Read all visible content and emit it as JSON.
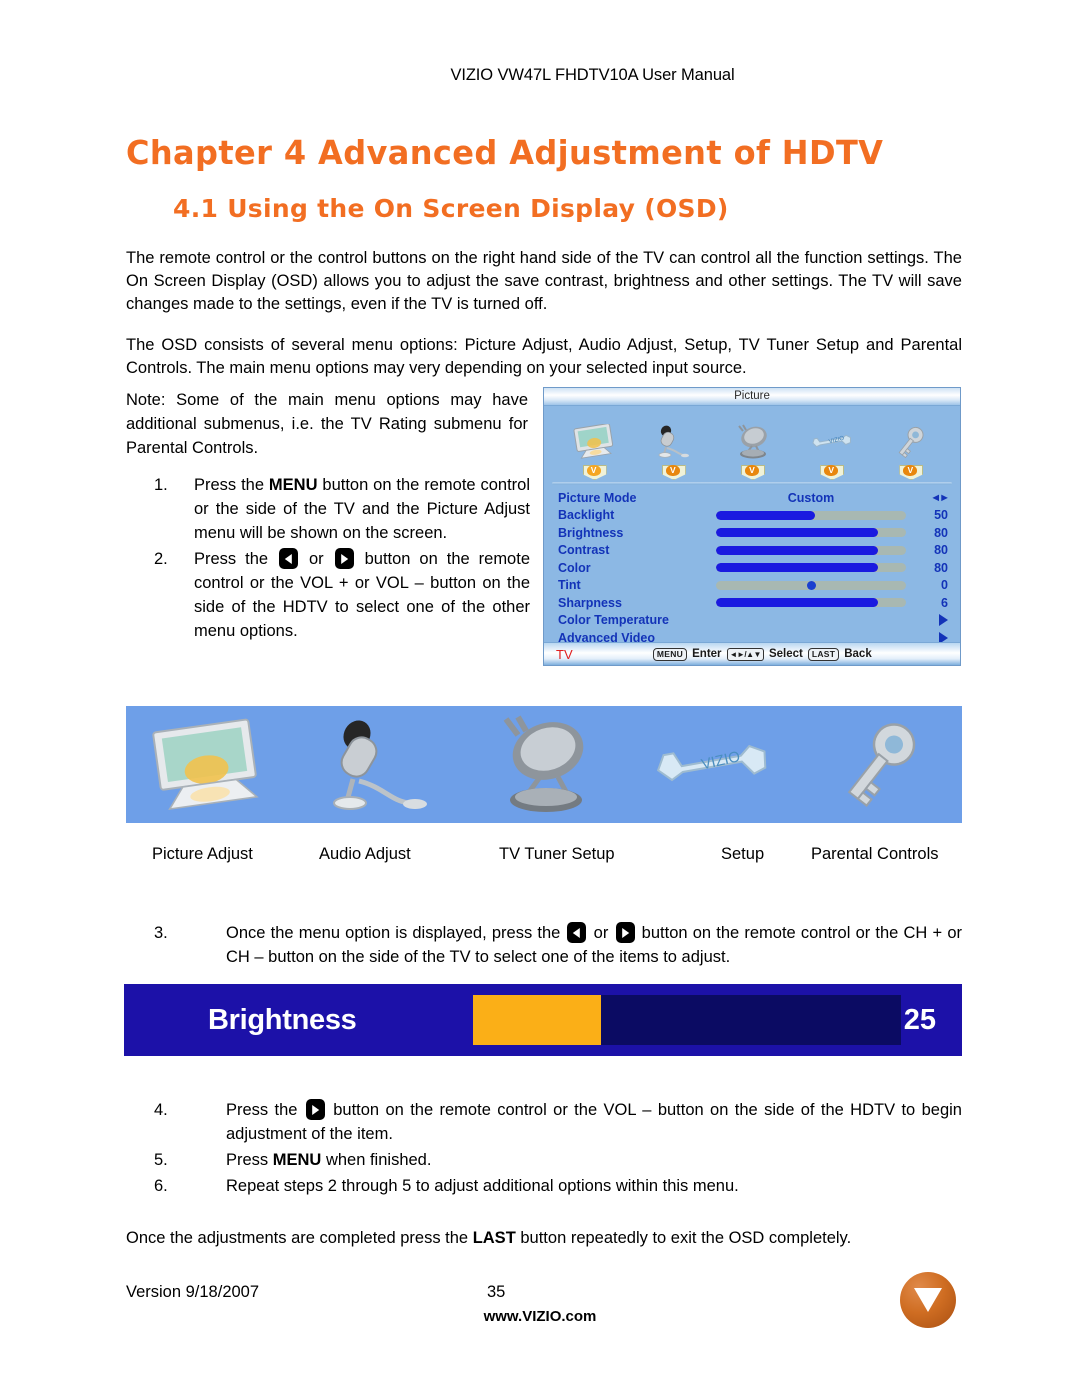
{
  "header": {
    "running_title": "VIZIO VW47L FHDTV10A User Manual"
  },
  "headings": {
    "chapter": "Chapter 4 Advanced Adjustment of HDTV",
    "section": "4.1 Using the On Screen Display (OSD)",
    "accent_color": "#F26E22"
  },
  "paragraphs": {
    "intro": "The remote control or the control buttons on the right hand side of the TV can control all the function settings.  The On Screen Display (OSD) allows you to adjust the save contrast, brightness and other settings.  The TV will save changes made to the settings, even if the TV is turned off.",
    "osd_overview": "The OSD consists of several menu options: Picture Adjust, Audio Adjust, Setup, TV Tuner Setup and Parental Controls.  The main menu options may very depending on your selected input source.",
    "note": "Note:  Some of the main menu options may have additional submenus, i.e. the TV Rating submenu for Parental Controls.",
    "closing_pre": "Once the adjustments are completed press the ",
    "closing_bold": "LAST",
    "closing_post": " button repeatedly to exit the OSD completely."
  },
  "steps": {
    "one": {
      "num": "1.",
      "pre": "Press the ",
      "bold": "MENU",
      "post": " button on the remote control or the side of the TV and the Picture Adjust menu will be shown on the screen."
    },
    "two": {
      "num": "2.",
      "seg1": "Press the ",
      "seg2": " or ",
      "seg3": " button on the remote control or the VOL + or VOL – button on the side of the HDTV to select one of the other menu options."
    },
    "three": {
      "num": "3.",
      "seg1": "Once the menu option is displayed, press the ",
      "seg2": " or ",
      "seg3": " button on the remote control or the CH + or CH – button on the side of the TV to select one of the items to adjust."
    },
    "four": {
      "num": "4.",
      "seg1": "Press the ",
      "seg2": " button on the remote control or the VOL – button on the side of the HDTV to begin adjustment of the item."
    },
    "five": {
      "num": "5.",
      "pre": "Press ",
      "bold": "MENU",
      "post": " when finished."
    },
    "six": {
      "num": "6.",
      "text": "Repeat steps 2 through 5 to adjust additional options within this menu."
    }
  },
  "osd": {
    "title": "Picture",
    "source_label": "TV",
    "source_color": "#e02020",
    "text_color": "#1333b8",
    "background": "#8cb8e4",
    "icons": [
      {
        "name": "monitor-icon",
        "label": "Picture Adjust",
        "active": true
      },
      {
        "name": "microphone-icon",
        "label": "Audio Adjust",
        "active": false
      },
      {
        "name": "satellite-dish-icon",
        "label": "TV Tuner Setup",
        "active": false
      },
      {
        "name": "wrench-icon",
        "label": "Setup",
        "active": false
      },
      {
        "name": "key-icon",
        "label": "Parental Controls",
        "active": false
      }
    ],
    "rows": [
      {
        "label": "Picture Mode",
        "type": "option",
        "value": "Custom"
      },
      {
        "label": "Backlight",
        "type": "slider",
        "value": "50",
        "fill_pct": 52
      },
      {
        "label": "Brightness",
        "type": "slider",
        "value": "80",
        "fill_pct": 85
      },
      {
        "label": "Contrast",
        "type": "slider",
        "value": "80",
        "fill_pct": 85
      },
      {
        "label": "Color",
        "type": "slider",
        "value": "80",
        "fill_pct": 85
      },
      {
        "label": "Tint",
        "type": "center-slider",
        "value": "0",
        "fill_pct": 50
      },
      {
        "label": "Sharpness",
        "type": "slider",
        "value": "6",
        "fill_pct": 85
      },
      {
        "label": "Color Temperature",
        "type": "submenu",
        "value": ""
      },
      {
        "label": "Advanced Video",
        "type": "submenu",
        "value": ""
      }
    ],
    "hints": {
      "menu_key": "MENU",
      "enter_label": "Enter",
      "nav_key": "◄►/▲▼",
      "select_label": "Select",
      "last_key": "LAST",
      "back_label": "Back"
    }
  },
  "icon_band": {
    "background": "#6e9fe8",
    "labels": [
      "Picture Adjust",
      "Audio Adjust",
      "TV Tuner Setup",
      "Setup",
      "Parental Controls"
    ]
  },
  "brightness_bar": {
    "label": "Brightness",
    "value": "25",
    "fill_pct": 30,
    "bar_color": "#1C11A8",
    "track_color": "#0B0B63",
    "fill_color": "#FBAF17",
    "text_color": "#FFFFFF"
  },
  "footer": {
    "version": "Version 9/18/2007",
    "page_number": "35",
    "website": "www.VIZIO.com"
  }
}
